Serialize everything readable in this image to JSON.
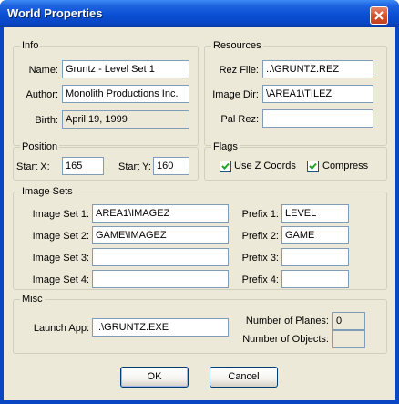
{
  "window": {
    "title": "World Properties"
  },
  "info": {
    "label": "Info",
    "name_label": "Name:",
    "name_value": "Gruntz - Level Set 1",
    "author_label": "Author:",
    "author_value": "Monolith Productions Inc.",
    "birth_label": "Birth:",
    "birth_value": "April 19, 1999"
  },
  "resources": {
    "label": "Resources",
    "rez_label": "Rez File:",
    "rez_value": "..\\GRUNTZ.REZ",
    "image_dir_label": "Image Dir:",
    "image_dir_value": "\\AREA1\\TILEZ",
    "pal_rez_label": "Pal Rez:",
    "pal_rez_value": ""
  },
  "position": {
    "label": "Position",
    "start_x_label": "Start X:",
    "start_x_value": "165",
    "start_y_label": "Start Y:",
    "start_y_value": "160"
  },
  "flags": {
    "label": "Flags",
    "use_z_label": "Use Z Coords",
    "use_z_checked": true,
    "compress_label": "Compress",
    "compress_checked": true
  },
  "image_sets": {
    "label": "Image Sets",
    "sets": [
      {
        "label": "Image Set 1:",
        "value": "AREA1\\IMAGEZ"
      },
      {
        "label": "Image Set 2:",
        "value": "GAME\\IMAGEZ"
      },
      {
        "label": "Image Set 3:",
        "value": ""
      },
      {
        "label": "Image Set 4:",
        "value": ""
      }
    ],
    "prefixes": [
      {
        "label": "Prefix 1:",
        "value": "LEVEL"
      },
      {
        "label": "Prefix 2:",
        "value": "GAME"
      },
      {
        "label": "Prefix 3:",
        "value": ""
      },
      {
        "label": "Prefix 4:",
        "value": ""
      }
    ]
  },
  "misc": {
    "label": "Misc",
    "launch_label": "Launch App:",
    "launch_value": "..\\GRUNTZ.EXE",
    "planes_label": "Number of Planes:",
    "planes_value": "0",
    "objects_label": "Number of Objects:",
    "objects_value": ""
  },
  "buttons": {
    "ok": "OK",
    "cancel": "Cancel"
  }
}
